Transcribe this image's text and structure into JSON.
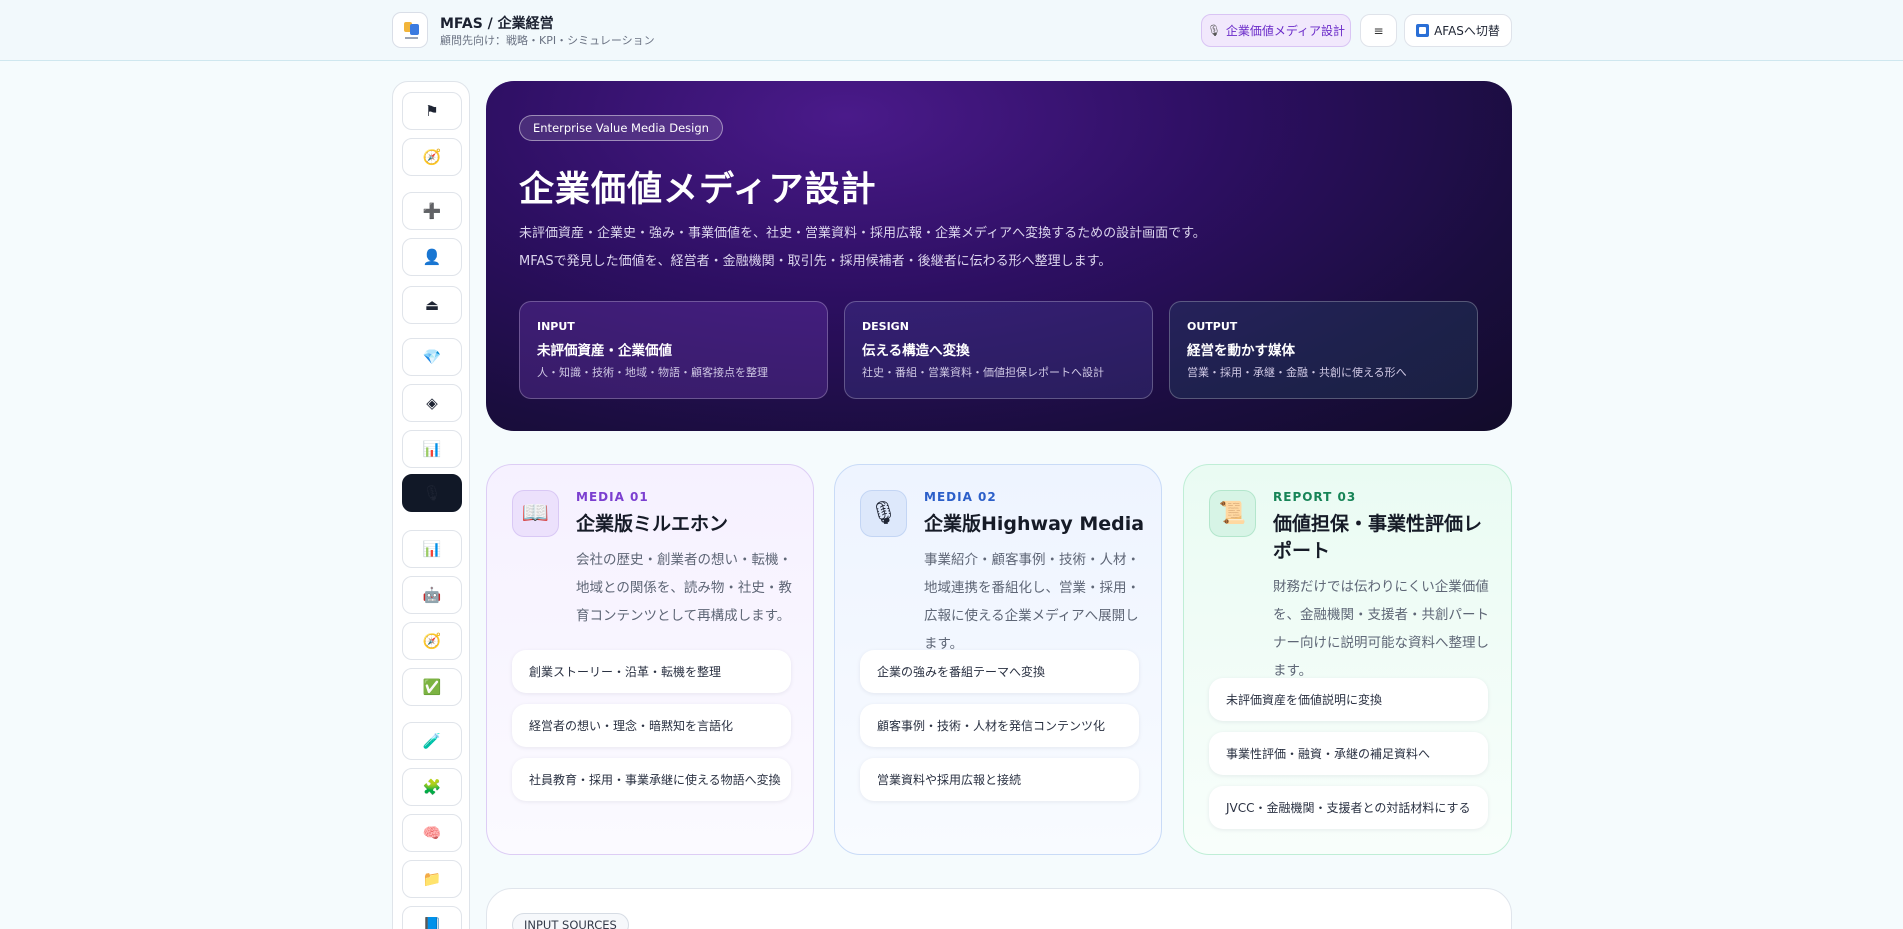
{
  "header": {
    "app_title": "MFAS / 企業経営",
    "app_subtitle": "顧問先向け：戦略・KPI・シミュレーション",
    "media_button": "企業価値メディア設計",
    "menu_button": "≡",
    "afas_button": "AFASへ切替"
  },
  "sidebar": {
    "items": [
      {
        "icon": "flag-icon",
        "glyph": "⚑"
      },
      {
        "icon": "compass-icon",
        "glyph": "🧭"
      },
      {
        "icon": "plus-icon",
        "glyph": "➕"
      },
      {
        "icon": "person-icon",
        "glyph": "👤"
      },
      {
        "icon": "stamp-icon",
        "glyph": "⏏"
      },
      {
        "icon": "gem-icon",
        "glyph": "💎"
      },
      {
        "icon": "diamond-icon",
        "glyph": "◈"
      },
      {
        "icon": "bar-chart-icon",
        "glyph": "📊"
      },
      {
        "icon": "microphone-icon",
        "glyph": "🎙",
        "active": true
      },
      {
        "icon": "bar-chart-icon",
        "glyph": "📊"
      },
      {
        "icon": "robot-icon",
        "glyph": "🤖"
      },
      {
        "icon": "compass-icon",
        "glyph": "🧭"
      },
      {
        "icon": "check-icon",
        "glyph": "✅"
      },
      {
        "icon": "test-tube-icon",
        "glyph": "🧪"
      },
      {
        "icon": "puzzle-icon",
        "glyph": "🧩"
      },
      {
        "icon": "brain-icon",
        "glyph": "🧠"
      },
      {
        "icon": "folder-icon",
        "glyph": "📁"
      },
      {
        "icon": "book-icon",
        "glyph": "📘"
      }
    ]
  },
  "hero": {
    "pill": "Enterprise Value Media Design",
    "title": "企業価値メディア設計",
    "desc1": "未評価資産・企業史・強み・事業価値を、社史・営業資料・採用広報・企業メディアへ変換するための設計画面です。",
    "desc2": "MFASで発見した価値を、経営者・金融機関・取引先・採用候補者・後継者に伝わる形へ整理します。",
    "steps": [
      {
        "kicker": "INPUT",
        "title": "未評価資産・企業価値",
        "desc": "人・知識・技術・地域・物語・顧客接点を整理"
      },
      {
        "kicker": "DESIGN",
        "title": "伝える構造へ変換",
        "desc": "社史・番組・営業資料・価値担保レポートへ設計"
      },
      {
        "kicker": "OUTPUT",
        "title": "経営を動かす媒体",
        "desc": "営業・採用・承継・金融・共創に使える形へ"
      }
    ]
  },
  "media": [
    {
      "kicker": "MEDIA 01",
      "title": "企業版ミルエホン",
      "body": "会社の歴史・創業者の想い・転機・地域との関係を、読み物・社史・教育コンテンツとして再構成します。",
      "icon": "book-icon",
      "glyph": "📖",
      "chips": [
        "創業ストーリー・沿革・転機を整理",
        "経営者の想い・理念・暗黙知を言語化",
        "社員教育・採用・事業承継に使える物語へ変換"
      ]
    },
    {
      "kicker": "MEDIA 02",
      "title": "企業版Highway Media",
      "body": "事業紹介・顧客事例・技術・人材・地域連携を番組化し、営業・採用・広報に使える企業メディアへ展開します。",
      "icon": "microphone-icon",
      "glyph": "🎙",
      "chips": [
        "企業の強みを番組テーマへ変換",
        "顧客事例・技術・人材を発信コンテンツ化",
        "営業資料や採用広報と接続"
      ]
    },
    {
      "kicker": "REPORT 03",
      "title": "価値担保・事業性評価レポート",
      "body": "財務だけでは伝わりにくい企業価値を、金融機関・支援者・共創パートナー向けに説明可能な資料へ整理します。",
      "icon": "scroll-icon",
      "glyph": "📜",
      "chips": [
        "未評価資産を価値説明に変換",
        "事業性評価・融資・承継の補足資料へ",
        "JVCC・金融機関・支援者との対話材料にする"
      ]
    }
  ],
  "bottom": {
    "pill": "INPUT SOURCES"
  }
}
